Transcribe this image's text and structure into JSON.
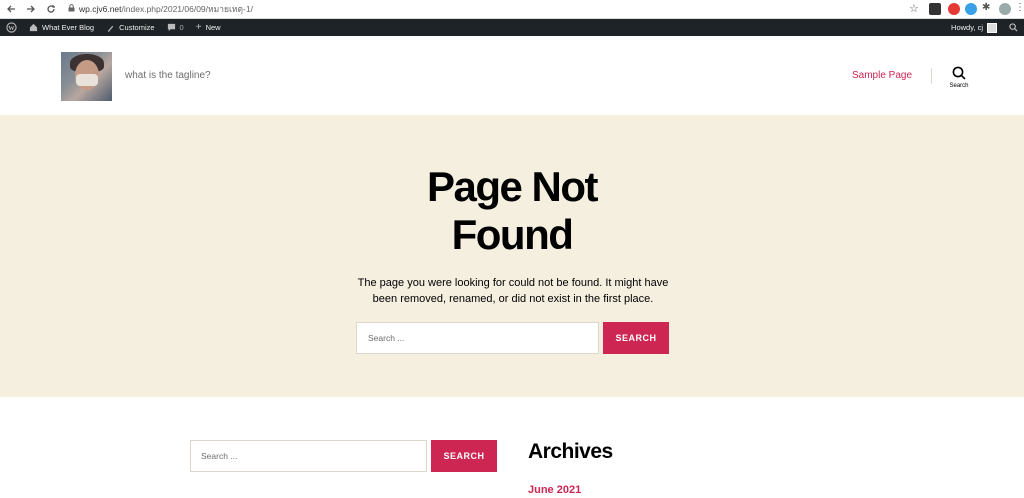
{
  "browser": {
    "back_icon": "arrow-left-icon",
    "forward_icon": "arrow-right-icon",
    "reload_icon": "reload-icon",
    "url_domain": "wp.cjv6.net",
    "url_path": "/index.php/2021/06/09/หมายเหตุ-1/"
  },
  "adminbar": {
    "site_name": "What Ever Blog",
    "customize": "Customize",
    "comments_count": "0",
    "new_label": "New",
    "howdy": "Howdy, cj"
  },
  "header": {
    "tagline": "what is the tagline?",
    "menu_item": "Sample Page",
    "search_label": "Search"
  },
  "hero": {
    "title": "Page Not Found",
    "description": "The page you were looking for could not be found. It might have been removed, renamed, or did not exist in the first place.",
    "search_placeholder": "Search ...",
    "search_button": "SEARCH"
  },
  "widgets": {
    "search_placeholder": "Search ...",
    "search_button": "SEARCH",
    "archives_title": "Archives",
    "archive_link": "June 2021"
  },
  "colors": {
    "accent": "#cd2653",
    "hero_bg": "#f5efe0",
    "adminbar_bg": "#1d2327"
  }
}
